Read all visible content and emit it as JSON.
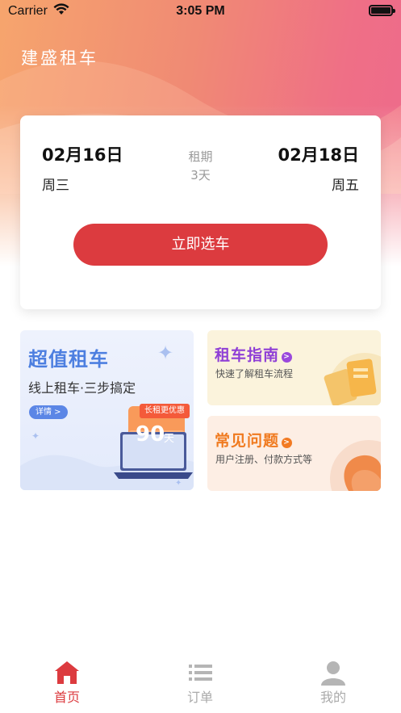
{
  "status_bar": {
    "carrier": "Carrier",
    "time": "3:05 PM",
    "wifi_icon": "wifi-icon",
    "battery_icon": "battery-icon"
  },
  "header": {
    "title": "建盛租车"
  },
  "booking": {
    "pickup_date": "02月16日",
    "pickup_weekday": "周三",
    "period_label": "租期",
    "period_days": "3天",
    "return_date": "02月18日",
    "return_weekday": "周五",
    "select_button": "立即选车"
  },
  "promo": {
    "title": "超值租车",
    "subtitle": "线上租车·三步搞定",
    "detail_label": "详情 >",
    "badge": "长租更优惠",
    "number": "90",
    "unit": "天"
  },
  "guide": {
    "title": "租车指南",
    "arrow": ">",
    "subtitle": "快速了解租车流程"
  },
  "faq": {
    "title": "常见问题",
    "arrow": ">",
    "subtitle": "用户注册、付款方式等"
  },
  "tabbar": {
    "items": [
      {
        "label": "首页",
        "icon": "home-icon",
        "active": true
      },
      {
        "label": "订单",
        "icon": "list-icon",
        "active": false
      },
      {
        "label": "我的",
        "icon": "user-icon",
        "active": false
      }
    ]
  },
  "colors": {
    "accent": "#dc3b3f",
    "promo_blue": "#4d7fe0",
    "guide_purple": "#8f3fd6",
    "faq_orange": "#f07a1f",
    "header_gradient_start": "#f6a56d",
    "header_gradient_end": "#ee6a8c"
  }
}
